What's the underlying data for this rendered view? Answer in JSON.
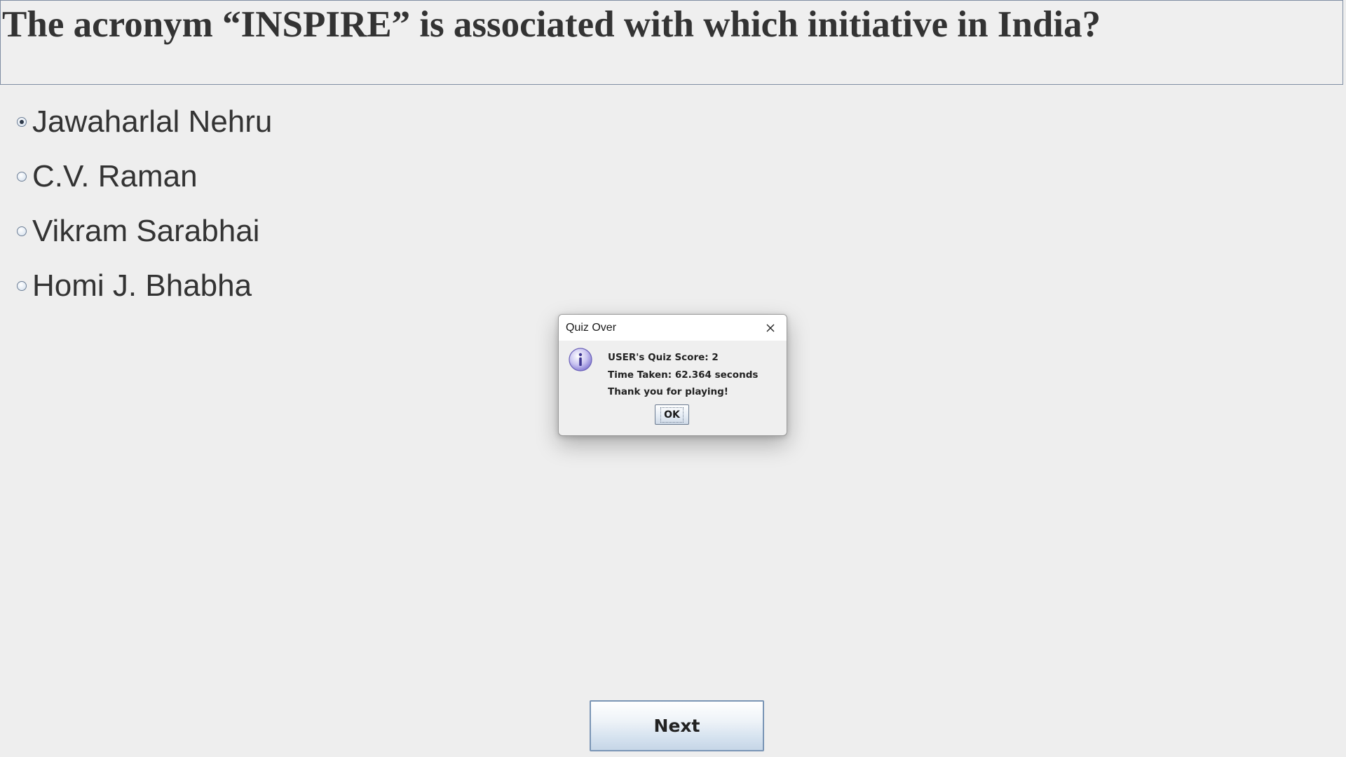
{
  "question": {
    "text": "The acronym “INSPIRE” is associated with which initiative in India?"
  },
  "options": [
    {
      "label": "Jawaharlal Nehru",
      "selected": true
    },
    {
      "label": "C.V. Raman",
      "selected": false
    },
    {
      "label": "Vikram Sarabhai",
      "selected": false
    },
    {
      "label": "Homi J. Bhabha",
      "selected": false
    }
  ],
  "dialog": {
    "title": "Quiz Over",
    "icon": "info-icon",
    "lines": [
      "USER's Quiz Score: 2",
      "Time Taken: 62.364 seconds",
      "Thank you for playing!"
    ],
    "ok_label": "OK"
  },
  "next_button": {
    "label": "Next"
  },
  "colors": {
    "background": "#eeeeee",
    "text": "#333333",
    "button_border": "#7a95b5",
    "info_icon": "#8c82d6"
  }
}
